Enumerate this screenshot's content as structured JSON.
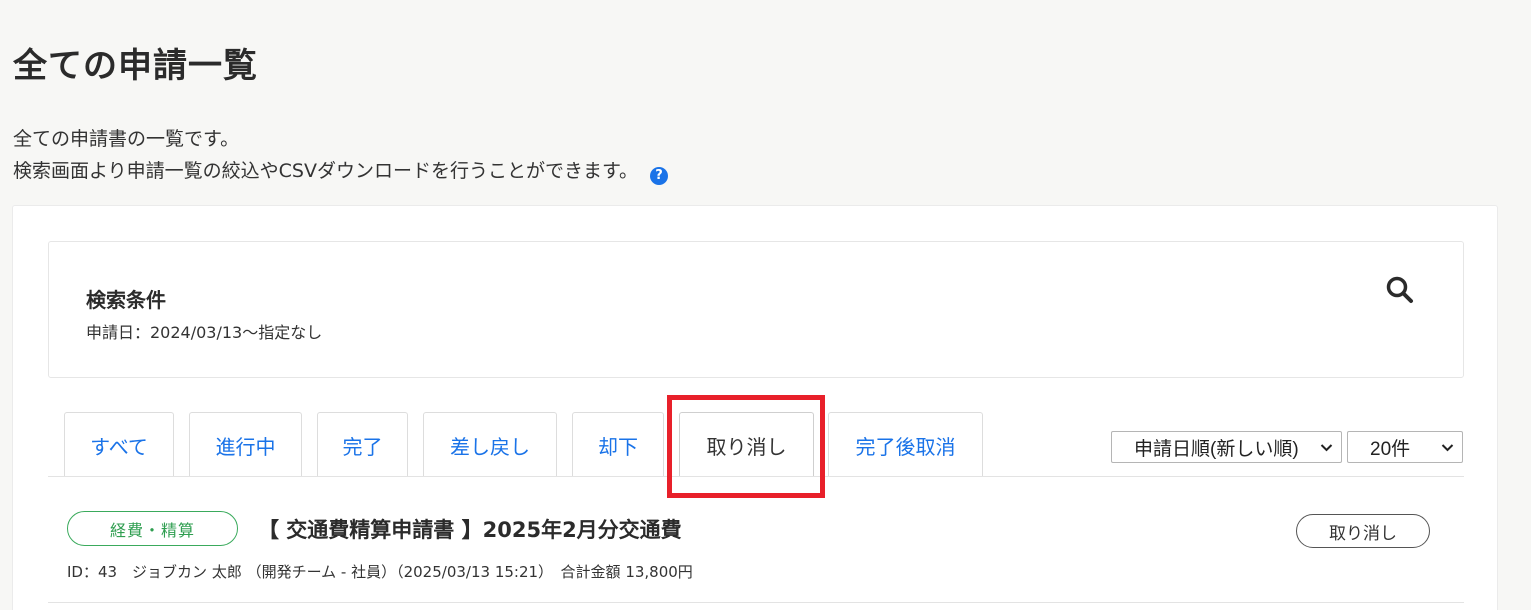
{
  "page": {
    "title": "全ての申請一覧",
    "description_line1": "全ての申請書の一覧です。",
    "description_line2": "検索画面より申請一覧の絞込やCSVダウンロードを行うことができます。",
    "help_icon": "question-circle-icon"
  },
  "search": {
    "title": "検索条件",
    "condition": "申請日：2024/03/13〜指定なし",
    "icon": "search-icon"
  },
  "tabs": [
    {
      "label": "すべて",
      "active": false
    },
    {
      "label": "進行中",
      "active": false
    },
    {
      "label": "完了",
      "active": false
    },
    {
      "label": "差し戻し",
      "active": false
    },
    {
      "label": "却下",
      "active": false
    },
    {
      "label": "取り消し",
      "active": true
    },
    {
      "label": "完了後取消",
      "active": false
    }
  ],
  "sort": {
    "selected": "申請日順(新しい順)"
  },
  "per_page": {
    "selected": "20件"
  },
  "items": [
    {
      "badge": "経費・精算",
      "title": "【 交通費精算申請書 】2025年2月分交通費",
      "meta": "ID：43　ジョブカン 太郎 （開発チーム - 社員）（2025/03/13 15:21）　合計金額 13,800円",
      "action_label": "取り消し"
    }
  ],
  "colors": {
    "accent": "#1a73e8",
    "badge_green": "#2f9e50",
    "highlight_red": "#e8202a"
  }
}
